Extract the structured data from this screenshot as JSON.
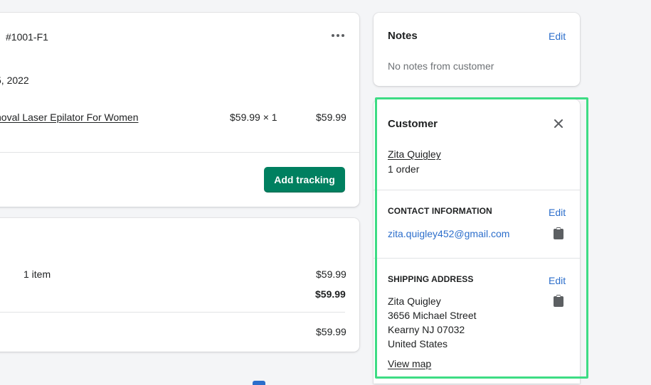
{
  "fulfillment": {
    "order_id": "#1001-F1",
    "date": "5, 2022",
    "product_link": "noval Laser Epilator For Women",
    "unit_price_qty": "$59.99 × 1",
    "line_total": "$59.99",
    "add_tracking_label": "Add tracking"
  },
  "payment": {
    "items_count": "1 item",
    "subtotal": "$59.99",
    "total": "$59.99",
    "paid": "$59.99"
  },
  "notes": {
    "title": "Notes",
    "edit_label": "Edit",
    "empty_text": "No notes from customer"
  },
  "customer": {
    "title": "Customer",
    "name": "Zita Quigley",
    "orders": "1 order",
    "contact_heading": "CONTACT INFORMATION",
    "contact_edit": "Edit",
    "email": "zita.quigley452@gmail.com",
    "shipping_heading": "SHIPPING ADDRESS",
    "shipping_edit": "Edit",
    "address": [
      "Zita Quigley",
      "3656 Michael Street",
      "Kearny NJ 07032",
      "United States"
    ],
    "view_map": "View map"
  },
  "colors": {
    "highlight": "#3ddc84",
    "primary": "#008060",
    "link": "#2c6ecb"
  }
}
